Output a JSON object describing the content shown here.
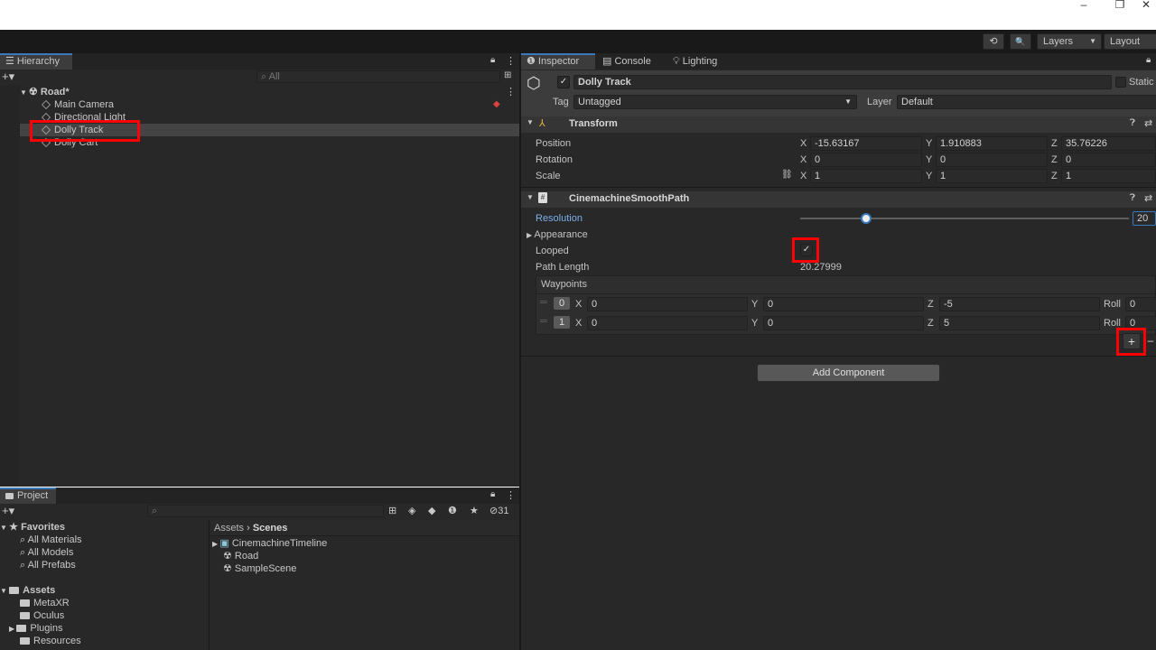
{
  "window": {
    "minimize": "–",
    "restore": "❐",
    "close": "✕"
  },
  "toolbar": {
    "history_icon": "⟲",
    "search_icon": "🔍",
    "layers_label": "Layers",
    "layout_label": "Layout"
  },
  "hierarchy": {
    "tab_label": "Hierarchy",
    "search_placeholder": "All",
    "scene_name": "Road*",
    "items": [
      "Main Camera",
      "Directional Light",
      "Dolly Track",
      "Dolly Cart"
    ]
  },
  "project": {
    "tab_label": "Project",
    "hidden_count": "31",
    "favorites_label": "Favorites",
    "favorites": [
      "All Materials",
      "All Models",
      "All Prefabs"
    ],
    "assets_label": "Assets",
    "assets": [
      "MetaXR",
      "Oculus",
      "Plugins",
      "Resources"
    ],
    "breadcrumb_root": "Assets",
    "breadcrumb_sep": "›",
    "breadcrumb_current": "Scenes",
    "scene_files": [
      "CinemachineTimeline",
      "Road",
      "SampleScene"
    ]
  },
  "inspector": {
    "tabs": [
      "Inspector",
      "Console",
      "Lighting"
    ],
    "object_name": "Dolly Track",
    "static_label": "Static",
    "tag_label": "Tag",
    "tag_value": "Untagged",
    "layer_label": "Layer",
    "layer_value": "Default",
    "transform": {
      "title": "Transform",
      "position_label": "Position",
      "rotation_label": "Rotation",
      "scale_label": "Scale",
      "position": {
        "x": "-15.63167",
        "y": "1.910883",
        "z": "35.76226"
      },
      "rotation": {
        "x": "0",
        "y": "0",
        "z": "0"
      },
      "scale": {
        "x": "1",
        "y": "1",
        "z": "1"
      }
    },
    "path": {
      "title": "CinemachineSmoothPath",
      "resolution_label": "Resolution",
      "resolution_value": "20",
      "resolution_fraction": 0.2,
      "appearance_label": "Appearance",
      "looped_label": "Looped",
      "looped_checked": true,
      "path_length_label": "Path Length",
      "path_length_value": "20.27999",
      "waypoints_label": "Waypoints",
      "waypoints": [
        {
          "index": "0",
          "x": "0",
          "y": "0",
          "z": "-5",
          "roll": "0"
        },
        {
          "index": "1",
          "x": "0",
          "y": "0",
          "z": "5",
          "roll": "0"
        }
      ],
      "roll_label": "Roll",
      "add_label": "+",
      "remove_label": "–"
    },
    "add_component_label": "Add Component"
  },
  "axis": {
    "x": "X",
    "y": "Y",
    "z": "Z"
  },
  "colors": {
    "accent": "#3a79bb",
    "highlight": "#ff0000",
    "panel": "#282828"
  }
}
